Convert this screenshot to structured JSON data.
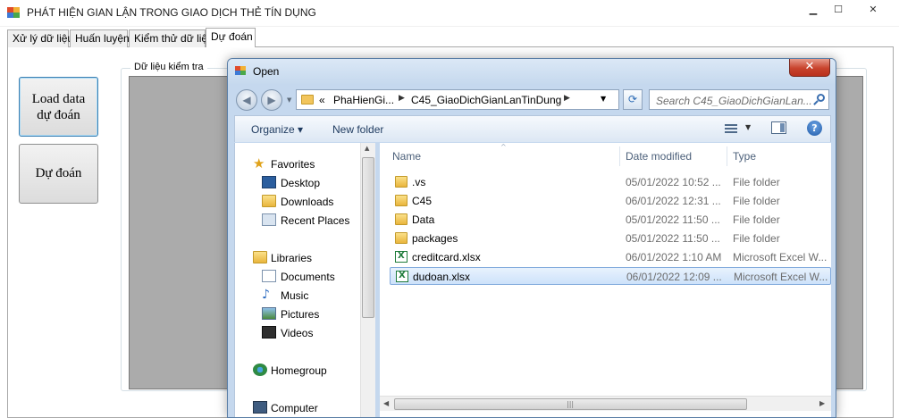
{
  "main_window": {
    "title": "PHÁT HIỆN GIAN LẬN TRONG GIAO DỊCH THẺ TÍN DỤNG",
    "minimize": "▁",
    "maximize": "☐",
    "close": "✕"
  },
  "tabs": [
    {
      "label": "Xử lý dữ liệu"
    },
    {
      "label": "Huấn luyện"
    },
    {
      "label": "Kiểm thử dữ liệu"
    },
    {
      "label": "Dự đoán"
    }
  ],
  "active_tab": "Dự đoán",
  "buttons": {
    "load_line1": "Load data",
    "load_line2": "dự đoán",
    "predict": "Dự đoán"
  },
  "groupbox": {
    "label": "Dữ liệu kiểm tra"
  },
  "dialog": {
    "title": "Open",
    "close": "✕",
    "breadcrumb": {
      "prefix": "«",
      "part1": "PhaHienGi...",
      "part2": "C45_GiaoDichGianLanTinDung"
    },
    "search_placeholder": "Search C45_GiaoDichGianLan...",
    "toolbar": {
      "organize": "Organize ▾",
      "new_folder": "New folder",
      "help": "?"
    },
    "nav": {
      "favorites": "Favorites",
      "desktop": "Desktop",
      "downloads": "Downloads",
      "recent": "Recent Places",
      "libraries": "Libraries",
      "documents": "Documents",
      "music": "Music",
      "pictures": "Pictures",
      "videos": "Videos",
      "homegroup": "Homegroup",
      "computer": "Computer"
    },
    "columns": {
      "name": "Name",
      "date": "Date modified",
      "type": "Type"
    },
    "files": [
      {
        "name": ".vs",
        "date": "05/01/2022 10:52 ...",
        "type": "File folder",
        "icon": "folder-icon"
      },
      {
        "name": "C45",
        "date": "06/01/2022 12:31 ...",
        "type": "File folder",
        "icon": "folder-icon"
      },
      {
        "name": "Data",
        "date": "05/01/2022 11:50 ...",
        "type": "File folder",
        "icon": "folder-icon"
      },
      {
        "name": "packages",
        "date": "05/01/2022 11:50 ...",
        "type": "File folder",
        "icon": "folder-icon"
      },
      {
        "name": "creditcard.xlsx",
        "date": "06/01/2022 1:10 AM",
        "type": "Microsoft Excel W...",
        "icon": "excel-file-icon"
      },
      {
        "name": "dudoan.xlsx",
        "date": "06/01/2022 12:09 ...",
        "type": "Microsoft Excel W...",
        "icon": "excel-file-icon",
        "selected": true
      }
    ]
  }
}
